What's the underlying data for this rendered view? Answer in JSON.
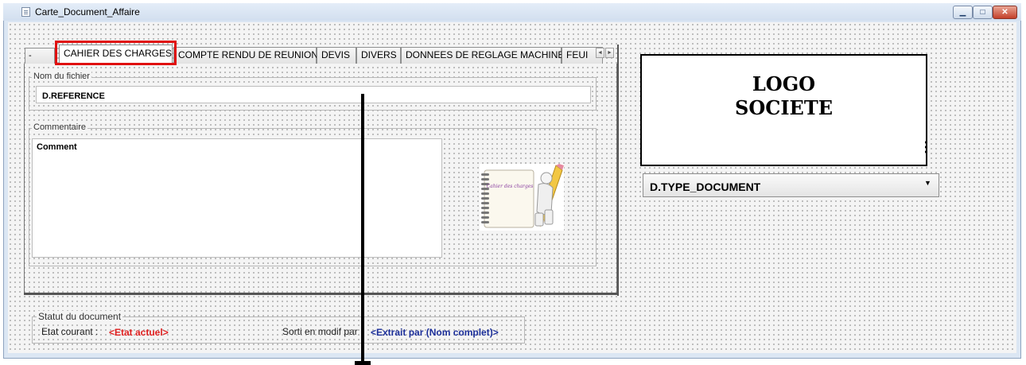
{
  "window": {
    "title": "Carte_Document_Affaire",
    "controls": {
      "minimize": "▁",
      "maximize": "□",
      "close": "✕"
    }
  },
  "tabs": {
    "leading": "-",
    "items": [
      {
        "label": "CAHIER DES CHARGES",
        "active": true
      },
      {
        "label": "COMPTE RENDU DE REUNION",
        "active": false
      },
      {
        "label": "DEVIS",
        "active": false
      },
      {
        "label": "DIVERS",
        "active": false
      },
      {
        "label": "DONNEES DE REGLAGE MACHINE",
        "active": false
      },
      {
        "label": "FEUI",
        "active": false
      }
    ],
    "scroll_left": "◄",
    "scroll_right": "►",
    "highlight_color": "#e01010"
  },
  "fichier": {
    "group_label": "Nom du fichier",
    "value": "D.REFERENCE"
  },
  "commentaire": {
    "group_label": "Commentaire",
    "value": "Comment",
    "image_caption": "Cahier des charges",
    "image_icon": "notebook-pencil-icon"
  },
  "logo": {
    "line1": "LOGO",
    "line2": "SOCIETE"
  },
  "type_document": {
    "value": "D.TYPE_DOCUMENT",
    "arrow": "▼"
  },
  "statut": {
    "group_label": "Statut du document",
    "etat_label": "Etat courant :",
    "etat_value": "<Etat actuel>",
    "etat_color": "#e02020",
    "sorti_label": "Sorti en modif par :",
    "sorti_value": "<Extrait par (Nom complet)>",
    "sorti_color": "#1c2f9a"
  }
}
